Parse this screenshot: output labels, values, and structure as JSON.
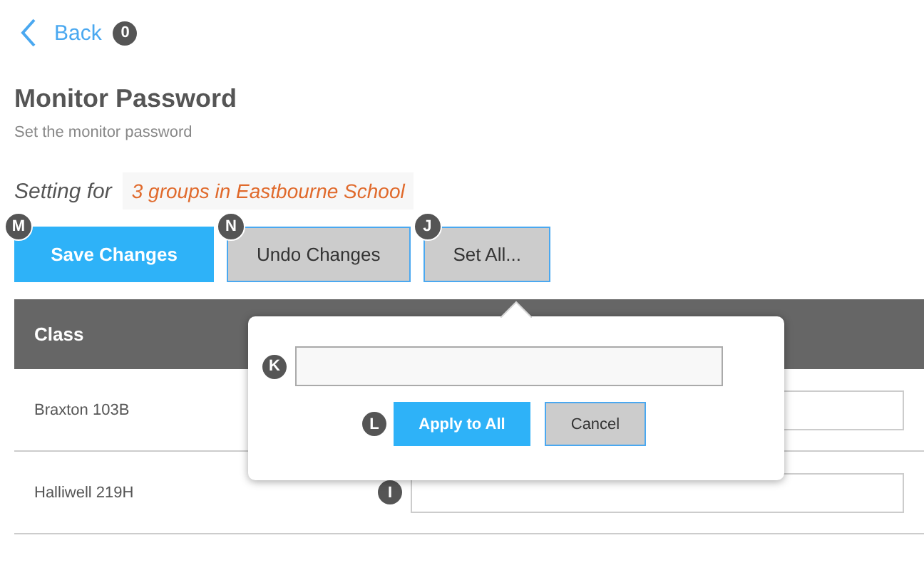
{
  "back": {
    "label": "Back",
    "badge": "0"
  },
  "title": "Monitor Password",
  "subtitle": "Set the monitor password",
  "setting": {
    "label": "Setting for",
    "target": "3 groups in Eastbourne School"
  },
  "buttons": [
    {
      "label": "Save Changes",
      "badge": "M",
      "kind": "primary"
    },
    {
      "label": "Undo Changes",
      "badge": "N",
      "kind": "secondary"
    },
    {
      "label": "Set All...",
      "badge": "J",
      "kind": "secondary"
    }
  ],
  "table": {
    "columns": [
      "Class"
    ],
    "rows": [
      {
        "class": "Braxton 103B"
      },
      {
        "class": "Halliwell 219H",
        "badge": "I"
      }
    ]
  },
  "popover": {
    "field_badge": "K",
    "actions_badge": "L",
    "buttons": [
      {
        "label": "Apply to All",
        "kind": "primary"
      },
      {
        "label": "Cancel",
        "kind": "secondary"
      }
    ]
  }
}
